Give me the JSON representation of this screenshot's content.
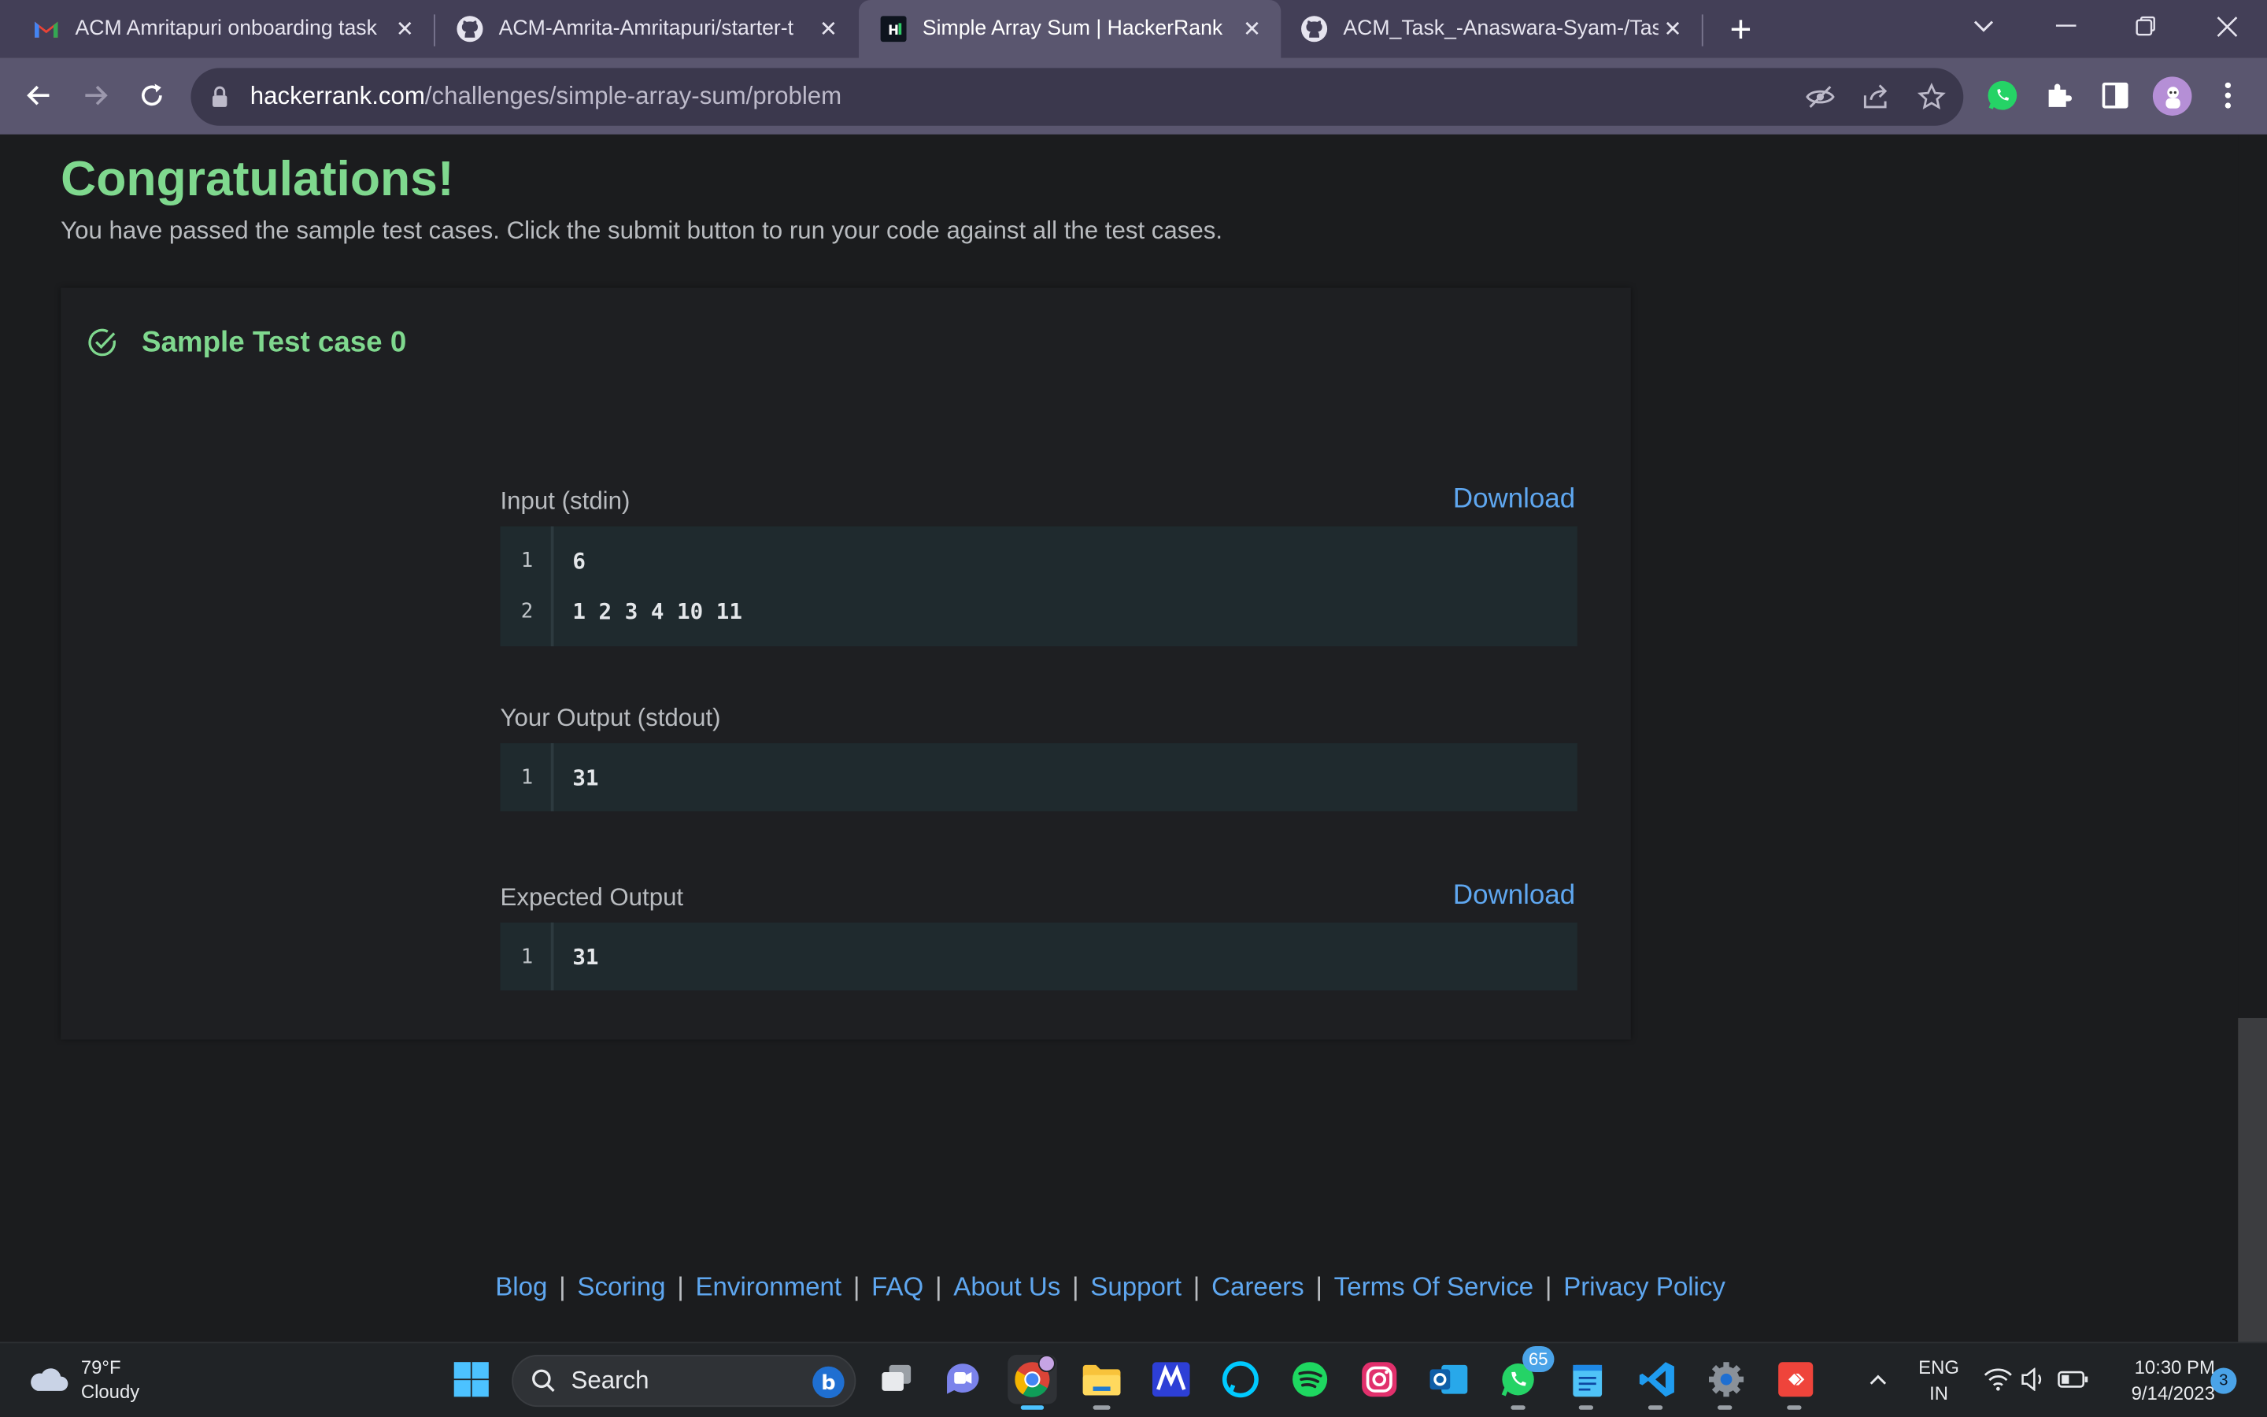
{
  "browser": {
    "tabs": [
      {
        "title": "ACM Amritapuri onboarding task",
        "icon": "gmail-icon",
        "active": false
      },
      {
        "title": "ACM-Amrita-Amritapuri/starter-t",
        "icon": "github-icon",
        "active": false
      },
      {
        "title": "Simple Array Sum | HackerRank",
        "icon": "hackerrank-icon",
        "active": true
      },
      {
        "title": "ACM_Task_-Anaswara-Syam-/Task",
        "icon": "github-icon",
        "active": false
      }
    ],
    "url_host": "hackerrank.com",
    "url_path": "/challenges/simple-array-sum/problem"
  },
  "page": {
    "heading": "Congratulations!",
    "subtext": "You have passed the sample test cases. Click the submit button to run your code against all the test cases.",
    "test_case": {
      "label": "Sample Test case 0",
      "input_label": "Input (stdin)",
      "download_label": "Download",
      "input_lines": [
        {
          "num": "1",
          "text": "6"
        },
        {
          "num": "2",
          "text": "1 2 3 4 10 11"
        }
      ],
      "output_label": "Your Output (stdout)",
      "output_lines": [
        {
          "num": "1",
          "text": "31"
        }
      ],
      "expected_label": "Expected Output",
      "expected_lines": [
        {
          "num": "1",
          "text": "31"
        }
      ]
    },
    "footer_links": [
      "Blog",
      "Scoring",
      "Environment",
      "FAQ",
      "About Us",
      "Support",
      "Careers",
      "Terms Of Service",
      "Privacy Policy"
    ],
    "footer_separator": "|"
  },
  "taskbar": {
    "weather_temp": "79°F",
    "weather_desc": "Cloudy",
    "search_label": "Search",
    "whatsapp_badge": "65",
    "lang_top": "ENG",
    "lang_bottom": "IN",
    "time": "10:30 PM",
    "date": "9/14/2023",
    "notification_count": "3"
  },
  "colors": {
    "success": "#7fd88e",
    "link": "#5fa7f0",
    "page_bg": "#1b1c1e",
    "code_bg": "#1f2a2e",
    "chrome": "#433f57"
  }
}
